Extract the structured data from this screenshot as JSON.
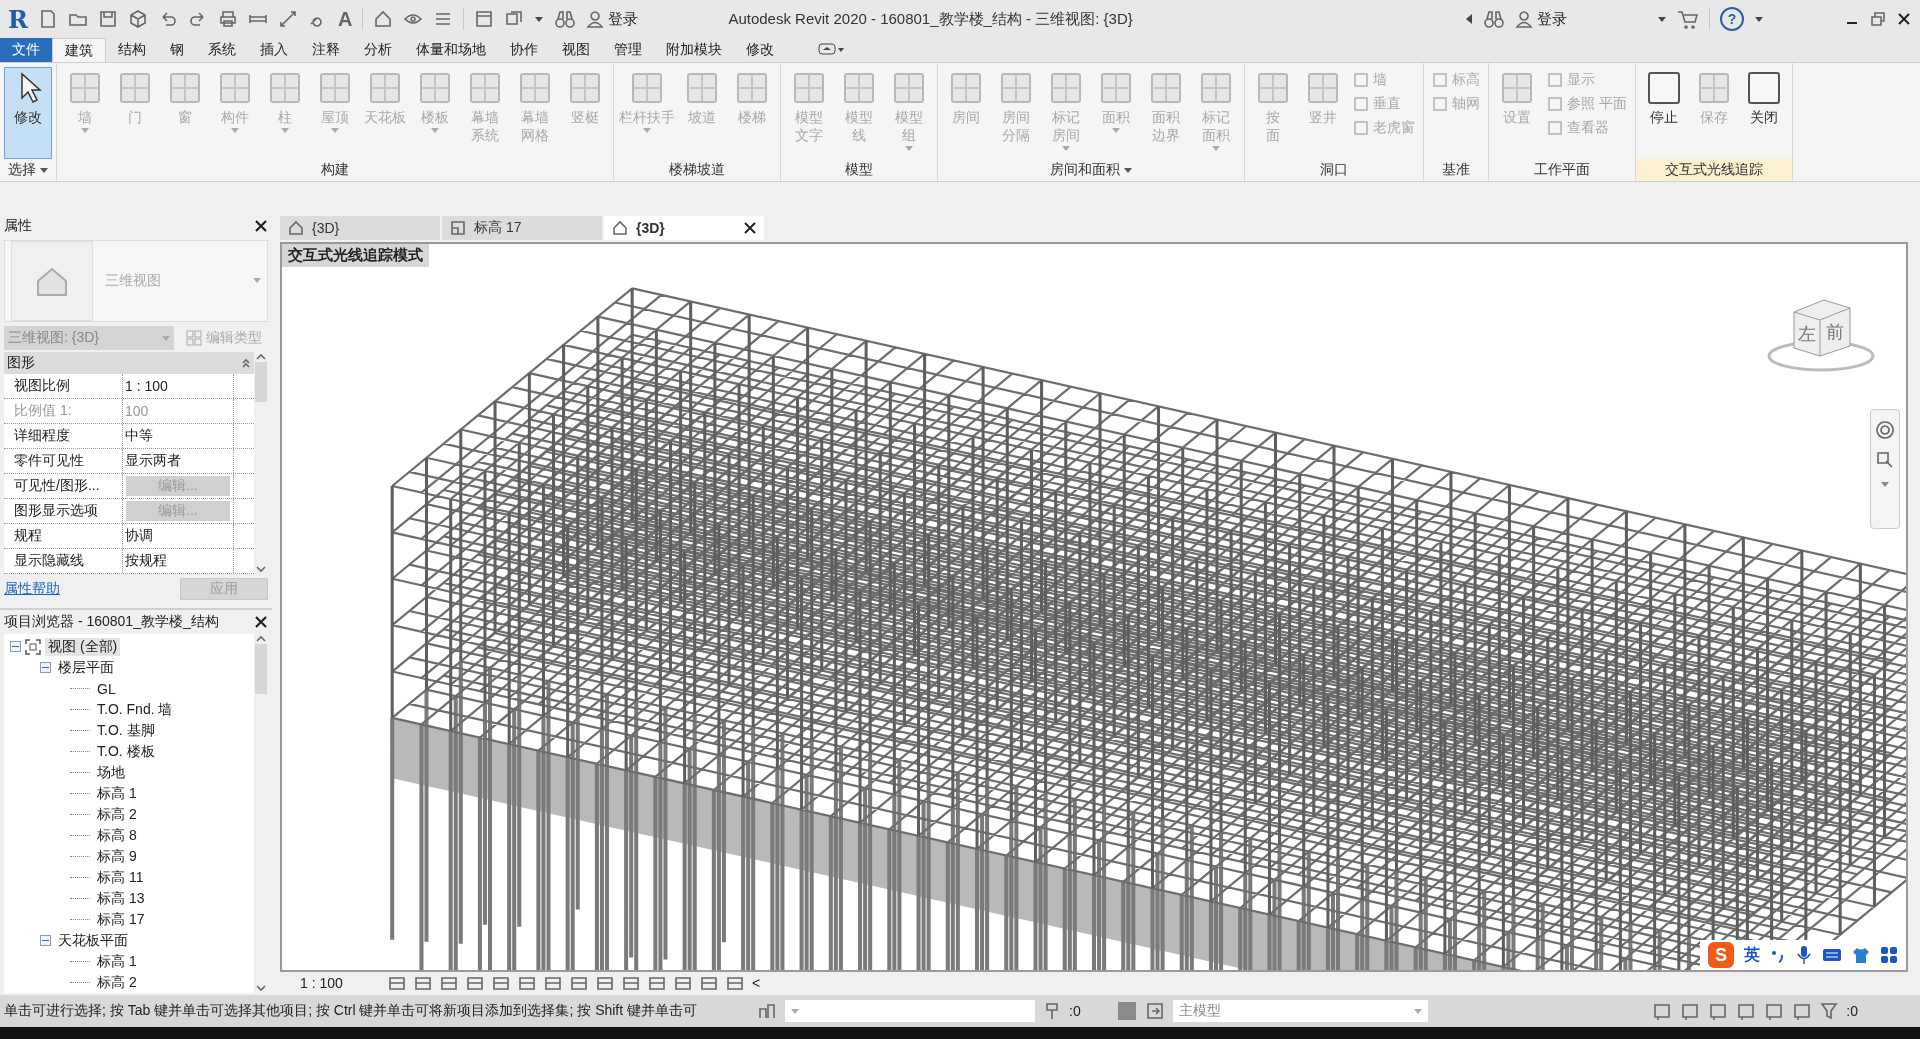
{
  "title_bar": {
    "logo": "R",
    "text_glyph": "A",
    "login_left": "登录",
    "title": "Autodesk Revit 2020 - 160801_教学楼_结构 - 三维视图: {3D}",
    "login_right": "登录",
    "help_glyph": "?"
  },
  "ribbon": {
    "tabs": [
      {
        "label": "文件",
        "kind": "file",
        "selected": false
      },
      {
        "label": "建筑",
        "kind": "tab",
        "selected": true
      },
      {
        "label": "结构",
        "kind": "tab",
        "selected": false
      },
      {
        "label": "钢",
        "kind": "tab",
        "selected": false
      },
      {
        "label": "系统",
        "kind": "tab",
        "selected": false
      },
      {
        "label": "插入",
        "kind": "tab",
        "selected": false
      },
      {
        "label": "注释",
        "kind": "tab",
        "selected": false
      },
      {
        "label": "分析",
        "kind": "tab",
        "selected": false
      },
      {
        "label": "体量和场地",
        "kind": "tab",
        "selected": false
      },
      {
        "label": "协作",
        "kind": "tab",
        "selected": false
      },
      {
        "label": "视图",
        "kind": "tab",
        "selected": false
      },
      {
        "label": "管理",
        "kind": "tab",
        "selected": false
      },
      {
        "label": "附加模块",
        "kind": "tab",
        "selected": false
      },
      {
        "label": "修改",
        "kind": "tab",
        "selected": false
      }
    ],
    "panels": [
      {
        "title": "选择",
        "dropdown": true,
        "contextual": false,
        "tools": [
          {
            "label": "修改",
            "kind": "large",
            "disabled": false,
            "active": true,
            "dropdown": false
          }
        ]
      },
      {
        "title": "构建",
        "dropdown": false,
        "contextual": false,
        "tools": [
          {
            "label": "墙",
            "kind": "large",
            "disabled": true,
            "active": false,
            "dropdown": true
          },
          {
            "label": "门",
            "kind": "large",
            "disabled": true,
            "active": false,
            "dropdown": false
          },
          {
            "label": "窗",
            "kind": "large",
            "disabled": true,
            "active": false,
            "dropdown": false
          },
          {
            "label": "构件",
            "kind": "large",
            "disabled": true,
            "active": false,
            "dropdown": true
          },
          {
            "label": "柱",
            "kind": "large",
            "disabled": true,
            "active": false,
            "dropdown": true
          },
          {
            "label": "屋顶",
            "kind": "large",
            "disabled": true,
            "active": false,
            "dropdown": true
          },
          {
            "label": "天花板",
            "kind": "wide",
            "disabled": true,
            "active": false,
            "dropdown": false
          },
          {
            "label": "楼板",
            "kind": "large",
            "disabled": true,
            "active": false,
            "dropdown": true
          },
          {
            "label": "幕墙系统",
            "kind": "large",
            "disabled": true,
            "active": false,
            "dropdown": false
          },
          {
            "label": "幕墙网格",
            "kind": "large",
            "disabled": true,
            "active": false,
            "dropdown": false
          },
          {
            "label": "竖梃",
            "kind": "large",
            "disabled": true,
            "active": false,
            "dropdown": false
          }
        ]
      },
      {
        "title": "楼梯坡道",
        "dropdown": false,
        "contextual": false,
        "tools": [
          {
            "label": "栏杆扶手",
            "kind": "wide",
            "disabled": true,
            "active": false,
            "dropdown": true
          },
          {
            "label": "坡道",
            "kind": "large",
            "disabled": true,
            "active": false,
            "dropdown": false
          },
          {
            "label": "楼梯",
            "kind": "large",
            "disabled": true,
            "active": false,
            "dropdown": false
          }
        ]
      },
      {
        "title": "模型",
        "dropdown": false,
        "contextual": false,
        "tools": [
          {
            "label": "模型文字",
            "kind": "large",
            "disabled": true,
            "active": false,
            "dropdown": false
          },
          {
            "label": "模型线",
            "kind": "large",
            "disabled": true,
            "active": false,
            "dropdown": false
          },
          {
            "label": "模型组",
            "kind": "large",
            "disabled": true,
            "active": false,
            "dropdown": true
          }
        ]
      },
      {
        "title": "房间和面积",
        "dropdown": true,
        "contextual": false,
        "tools": [
          {
            "label": "房间",
            "kind": "large",
            "disabled": true,
            "active": false,
            "dropdown": false
          },
          {
            "label": "房间分隔",
            "kind": "large",
            "disabled": true,
            "active": false,
            "dropdown": false
          },
          {
            "label": "标记房间",
            "kind": "large",
            "disabled": true,
            "active": false,
            "dropdown": true
          },
          {
            "label": "面积",
            "kind": "large",
            "disabled": true,
            "active": false,
            "dropdown": true
          },
          {
            "label": "面积边界",
            "kind": "large",
            "disabled": true,
            "active": false,
            "dropdown": false
          },
          {
            "label": "标记面积",
            "kind": "large",
            "disabled": true,
            "active": false,
            "dropdown": true
          }
        ]
      },
      {
        "title": "洞口",
        "dropdown": false,
        "contextual": false,
        "tools": [
          {
            "label": "按面",
            "kind": "narrow",
            "disabled": true,
            "active": false,
            "dropdown": false
          },
          {
            "label": "竖井",
            "kind": "large",
            "disabled": true,
            "active": false,
            "dropdown": false
          },
          {
            "label": "墙",
            "kind": "small",
            "disabled": true,
            "active": false,
            "dropdown": false
          },
          {
            "label": "垂直",
            "kind": "small",
            "disabled": true,
            "active": false,
            "dropdown": false
          },
          {
            "label": "老虎窗",
            "kind": "small",
            "disabled": true,
            "active": false,
            "dropdown": false
          }
        ]
      },
      {
        "title": "基准",
        "dropdown": false,
        "contextual": false,
        "tools": [
          {
            "label": "标高",
            "kind": "small",
            "disabled": true,
            "active": false,
            "dropdown": false
          },
          {
            "label": "轴网",
            "kind": "small",
            "disabled": true,
            "active": false,
            "dropdown": false
          }
        ]
      },
      {
        "title": "工作平面",
        "dropdown": false,
        "contextual": false,
        "tools": [
          {
            "label": "设置",
            "kind": "large",
            "disabled": true,
            "active": false,
            "dropdown": false
          },
          {
            "label": "显示",
            "kind": "small",
            "disabled": true,
            "active": false,
            "dropdown": false
          },
          {
            "label": "参照 平面",
            "kind": "small",
            "disabled": true,
            "active": false,
            "dropdown": false
          },
          {
            "label": "查看器",
            "kind": "small",
            "disabled": true,
            "active": false,
            "dropdown": false
          }
        ]
      },
      {
        "title": "交互式光线追踪",
        "dropdown": false,
        "contextual": true,
        "tools": [
          {
            "label": "停止",
            "kind": "large",
            "disabled": false,
            "active": false,
            "dropdown": false
          },
          {
            "label": "保存",
            "kind": "large",
            "disabled": true,
            "active": false,
            "dropdown": false
          },
          {
            "label": "关闭",
            "kind": "large",
            "disabled": false,
            "active": false,
            "dropdown": false
          }
        ]
      }
    ]
  },
  "properties": {
    "title": "属性",
    "type_name": "三维视图",
    "instance": "三维视图: {3D}",
    "edit_type": "编辑类型",
    "section": "图形",
    "rows": [
      {
        "label": "视图比例",
        "value": "1 : 100",
        "kind": "text",
        "disabled": false
      },
      {
        "label": "比例值 1:",
        "value": "100",
        "kind": "text",
        "disabled": true
      },
      {
        "label": "详细程度",
        "value": "中等",
        "kind": "text",
        "disabled": false
      },
      {
        "label": "零件可见性",
        "value": "显示两者",
        "kind": "text",
        "disabled": false
      },
      {
        "label": "可见性/图形...",
        "value": "编辑...",
        "kind": "button",
        "disabled": false
      },
      {
        "label": "图形显示选项",
        "value": "编辑...",
        "kind": "button",
        "disabled": false
      },
      {
        "label": "规程",
        "value": "协调",
        "kind": "text",
        "disabled": false
      },
      {
        "label": "显示隐藏线",
        "value": "按规程",
        "kind": "text",
        "disabled": false
      }
    ],
    "help_link": "属性帮助",
    "apply": "应用"
  },
  "project_browser": {
    "title": "项目浏览器 - 160801_教学楼_结构",
    "tree": [
      {
        "label": "视图 (全部)",
        "expanded": true,
        "selected": true,
        "children": [
          {
            "label": "楼层平面",
            "expanded": true,
            "selected": false,
            "children": [
              {
                "label": "GL",
                "selected": false
              },
              {
                "label": "T.O. Fnd. 墙",
                "selected": false
              },
              {
                "label": "T.O. 基脚",
                "selected": false
              },
              {
                "label": "T.O. 楼板",
                "selected": false
              },
              {
                "label": "场地",
                "selected": false
              },
              {
                "label": "标高 1",
                "selected": false
              },
              {
                "label": "标高 2",
                "selected": false
              },
              {
                "label": "标高 8",
                "selected": false
              },
              {
                "label": "标高 9",
                "selected": false
              },
              {
                "label": "标高 11",
                "selected": false
              },
              {
                "label": "标高 13",
                "selected": false
              },
              {
                "label": "标高 17",
                "selected": false
              }
            ]
          },
          {
            "label": "天花板平面",
            "expanded": true,
            "selected": false,
            "children": [
              {
                "label": "标高 1",
                "selected": false
              },
              {
                "label": "标高 2",
                "selected": false
              }
            ]
          }
        ]
      }
    ]
  },
  "view_tabs": [
    {
      "label": "{3D}",
      "kind": "isometric",
      "selected": false
    },
    {
      "label": "标高 17",
      "kind": "plan",
      "selected": false
    },
    {
      "label": "{3D}",
      "kind": "isometric",
      "selected": true
    }
  ],
  "viewport": {
    "mode_label": "交互式光线追踪模式",
    "viewcube": {
      "left": "左",
      "front": "前"
    }
  },
  "view_control_bar": {
    "scale": "1 : 100",
    "collapse": "<"
  },
  "ime": {
    "logo": "S",
    "mode": "英"
  },
  "status_bar": {
    "message": "单击可进行选择; 按 Tab 键并单击可选择其他项目; 按 Ctrl 键并单击可将新项目添加到选择集; 按 Shift 键并单击可",
    "count": ":0",
    "model": "主模型",
    "filter_count": ":0"
  }
}
